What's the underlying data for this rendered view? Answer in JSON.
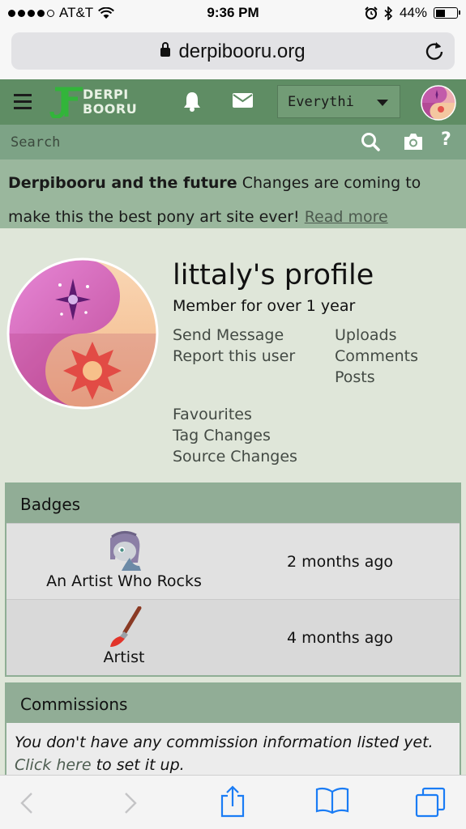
{
  "status_bar": {
    "carrier": "AT&T",
    "time": "9:36 PM",
    "battery": "44%",
    "battery_level": 0.44
  },
  "browser": {
    "url": "derpibooru.org"
  },
  "header": {
    "logo_line1": "DERPI",
    "logo_line2": "BOORU",
    "filter_label": "Everythi"
  },
  "search": {
    "placeholder": "Search"
  },
  "announcement": {
    "title": "Derpibooru and the future",
    "text": "Changes are coming to make this the best pony art site ever!",
    "link": "Read more"
  },
  "profile": {
    "title": "littaly's profile",
    "member_since": "Member for over 1 year",
    "links_left": [
      "Send Message",
      "Report this user"
    ],
    "links_right": [
      "Uploads",
      "Comments",
      "Posts"
    ],
    "links_bottom": [
      "Favourites",
      "Tag Changes",
      "Source Changes"
    ]
  },
  "badges": {
    "title": "Badges",
    "items": [
      {
        "name": "An Artist Who Rocks",
        "time": "2 months ago"
      },
      {
        "name": "Artist",
        "time": "4 months ago"
      }
    ]
  },
  "commissions": {
    "title": "Commissions",
    "text_prefix": "You don't have any commission information listed yet.",
    "link": "Click here",
    "text_suffix": "to set it up."
  },
  "colors": {
    "header_green": "#5f8d64",
    "search_green": "#7da386",
    "page_bg": "#dfe6d9",
    "ios_blue": "#1a7cf5"
  }
}
